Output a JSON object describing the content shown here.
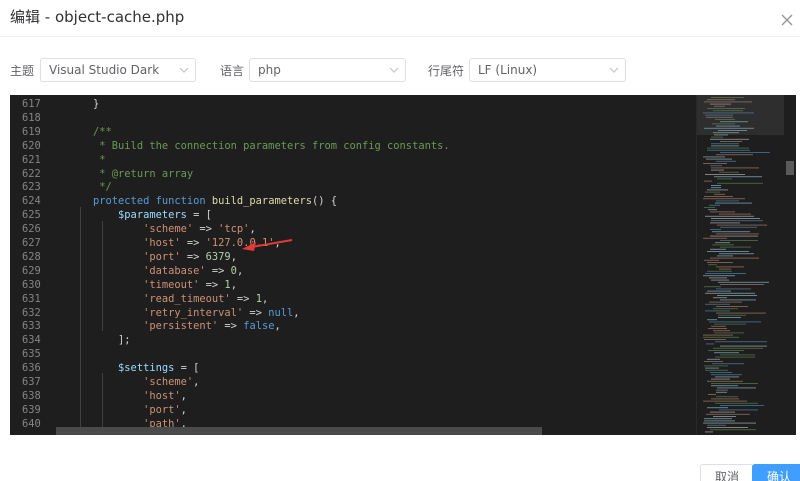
{
  "dialog": {
    "title": "编辑 - object-cache.php"
  },
  "toolbar": {
    "theme_label": "主题",
    "theme_value": "Visual Studio Dark",
    "language_label": "语言",
    "language_value": "php",
    "eol_label": "行尾符",
    "eol_value": "LF (Linux)"
  },
  "editor": {
    "lines": [
      {
        "num": "617",
        "tokens": [
          {
            "t": "    }",
            "c": "plain"
          }
        ]
      },
      {
        "num": "618",
        "tokens": []
      },
      {
        "num": "619",
        "tokens": [
          {
            "t": "    /**",
            "c": "comment"
          }
        ]
      },
      {
        "num": "620",
        "tokens": [
          {
            "t": "     * Build the connection parameters from config constants.",
            "c": "comment"
          }
        ]
      },
      {
        "num": "621",
        "tokens": [
          {
            "t": "     *",
            "c": "comment"
          }
        ]
      },
      {
        "num": "622",
        "tokens": [
          {
            "t": "     * @return array",
            "c": "comment"
          }
        ]
      },
      {
        "num": "623",
        "tokens": [
          {
            "t": "     */",
            "c": "comment"
          }
        ]
      },
      {
        "num": "624",
        "tokens": [
          {
            "t": "    protected function ",
            "c": "keyword"
          },
          {
            "t": "build_parameters",
            "c": "fn"
          },
          {
            "t": "() {",
            "c": "plain"
          }
        ]
      },
      {
        "num": "625",
        "tokens": [
          {
            "t": "        ",
            "c": "plain"
          },
          {
            "t": "$parameters",
            "c": "var"
          },
          {
            "t": " = [",
            "c": "plain"
          }
        ]
      },
      {
        "num": "626",
        "tokens": [
          {
            "t": "            ",
            "c": "plain"
          },
          {
            "t": "'scheme'",
            "c": "string"
          },
          {
            "t": " => ",
            "c": "plain"
          },
          {
            "t": "'tcp'",
            "c": "string"
          },
          {
            "t": ",",
            "c": "plain"
          }
        ]
      },
      {
        "num": "627",
        "tokens": [
          {
            "t": "            ",
            "c": "plain"
          },
          {
            "t": "'host'",
            "c": "string"
          },
          {
            "t": " => ",
            "c": "plain"
          },
          {
            "t": "'127.0.0.1'",
            "c": "string"
          },
          {
            "t": ",",
            "c": "plain"
          }
        ]
      },
      {
        "num": "628",
        "tokens": [
          {
            "t": "            ",
            "c": "plain"
          },
          {
            "t": "'port'",
            "c": "string"
          },
          {
            "t": " => ",
            "c": "plain"
          },
          {
            "t": "6379",
            "c": "num"
          },
          {
            "t": ",",
            "c": "plain"
          }
        ]
      },
      {
        "num": "629",
        "tokens": [
          {
            "t": "            ",
            "c": "plain"
          },
          {
            "t": "'database'",
            "c": "string"
          },
          {
            "t": " => ",
            "c": "plain"
          },
          {
            "t": "0",
            "c": "num"
          },
          {
            "t": ",",
            "c": "plain"
          }
        ]
      },
      {
        "num": "630",
        "tokens": [
          {
            "t": "            ",
            "c": "plain"
          },
          {
            "t": "'timeout'",
            "c": "string"
          },
          {
            "t": " => ",
            "c": "plain"
          },
          {
            "t": "1",
            "c": "num"
          },
          {
            "t": ",",
            "c": "plain"
          }
        ]
      },
      {
        "num": "631",
        "tokens": [
          {
            "t": "            ",
            "c": "plain"
          },
          {
            "t": "'read_timeout'",
            "c": "string"
          },
          {
            "t": " => ",
            "c": "plain"
          },
          {
            "t": "1",
            "c": "num"
          },
          {
            "t": ",",
            "c": "plain"
          }
        ]
      },
      {
        "num": "632",
        "tokens": [
          {
            "t": "            ",
            "c": "plain"
          },
          {
            "t": "'retry_interval'",
            "c": "string"
          },
          {
            "t": " => ",
            "c": "plain"
          },
          {
            "t": "null",
            "c": "keyword"
          },
          {
            "t": ",",
            "c": "plain"
          }
        ]
      },
      {
        "num": "633",
        "tokens": [
          {
            "t": "            ",
            "c": "plain"
          },
          {
            "t": "'persistent'",
            "c": "string"
          },
          {
            "t": " => ",
            "c": "plain"
          },
          {
            "t": "false",
            "c": "keyword"
          },
          {
            "t": ",",
            "c": "plain"
          }
        ]
      },
      {
        "num": "634",
        "tokens": [
          {
            "t": "        ];",
            "c": "plain"
          }
        ]
      },
      {
        "num": "635",
        "tokens": []
      },
      {
        "num": "636",
        "tokens": [
          {
            "t": "        ",
            "c": "plain"
          },
          {
            "t": "$settings",
            "c": "var"
          },
          {
            "t": " = [",
            "c": "plain"
          }
        ]
      },
      {
        "num": "637",
        "tokens": [
          {
            "t": "            ",
            "c": "plain"
          },
          {
            "t": "'scheme'",
            "c": "string"
          },
          {
            "t": ",",
            "c": "plain"
          }
        ]
      },
      {
        "num": "638",
        "tokens": [
          {
            "t": "            ",
            "c": "plain"
          },
          {
            "t": "'host'",
            "c": "string"
          },
          {
            "t": ",",
            "c": "plain"
          }
        ]
      },
      {
        "num": "639",
        "tokens": [
          {
            "t": "            ",
            "c": "plain"
          },
          {
            "t": "'port'",
            "c": "string"
          },
          {
            "t": ",",
            "c": "plain"
          }
        ]
      },
      {
        "num": "640",
        "tokens": [
          {
            "t": "            ",
            "c": "plain"
          },
          {
            "t": "'path'",
            "c": "string"
          },
          {
            "t": ",",
            "c": "plain"
          }
        ]
      }
    ]
  },
  "actions": {
    "cancel_label": "取消",
    "ok_label": "确认"
  },
  "colors": {
    "primary": "#409eff",
    "editor_bg": "#1e1e1e",
    "annotation_arrow": "#e53935"
  },
  "icons": [
    "close-icon",
    "chevron-down-icon"
  ]
}
